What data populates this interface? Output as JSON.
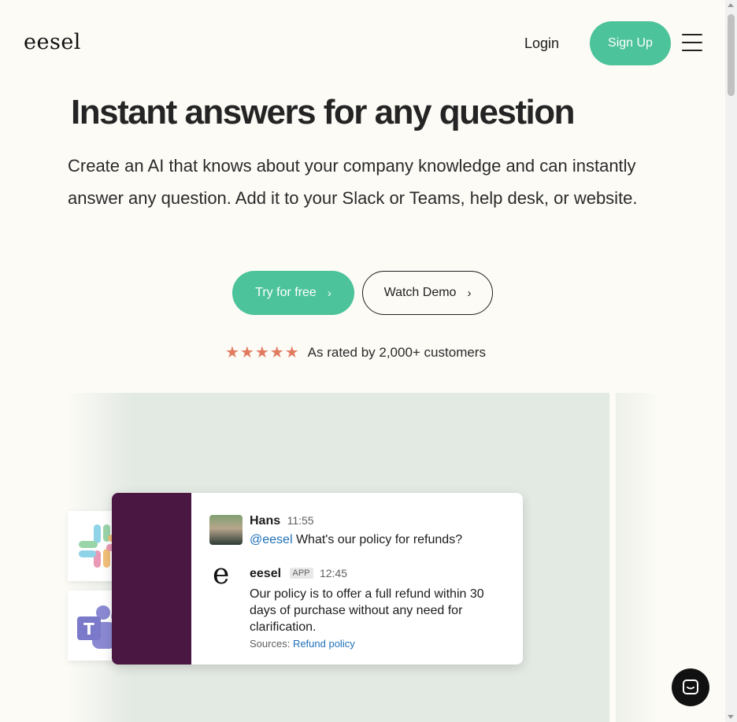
{
  "header": {
    "logo": "eesel",
    "login_label": "Login",
    "signup_label": "Sign Up"
  },
  "hero": {
    "headline": "Instant answers for any question",
    "subtext": "Create an AI that knows about your company knowledge and can instantly answer any question. Add it to your Slack or Teams, help desk, or website.",
    "try_label": "Try for free",
    "demo_label": "Watch Demo",
    "stars": "★★★★★",
    "rating_text": "As rated by 2,000+ customers"
  },
  "chat": {
    "user_name": "Hans",
    "user_time": "11:55",
    "mention": "@eesel",
    "question": " What's our policy for refunds?",
    "bot_name": "eesel",
    "bot_badge": "APP",
    "bot_time": "12:45",
    "bot_avatar": "e",
    "reply": "Our policy is to offer a full refund within 30 days of purchase without any need for clarification.",
    "sources_label": "Sources:",
    "sources_link": "Refund policy"
  },
  "colors": {
    "accent": "#4cc39a",
    "star": "#e17b5f",
    "slack_sidebar": "#4a1743",
    "link": "#1d6fb8"
  }
}
